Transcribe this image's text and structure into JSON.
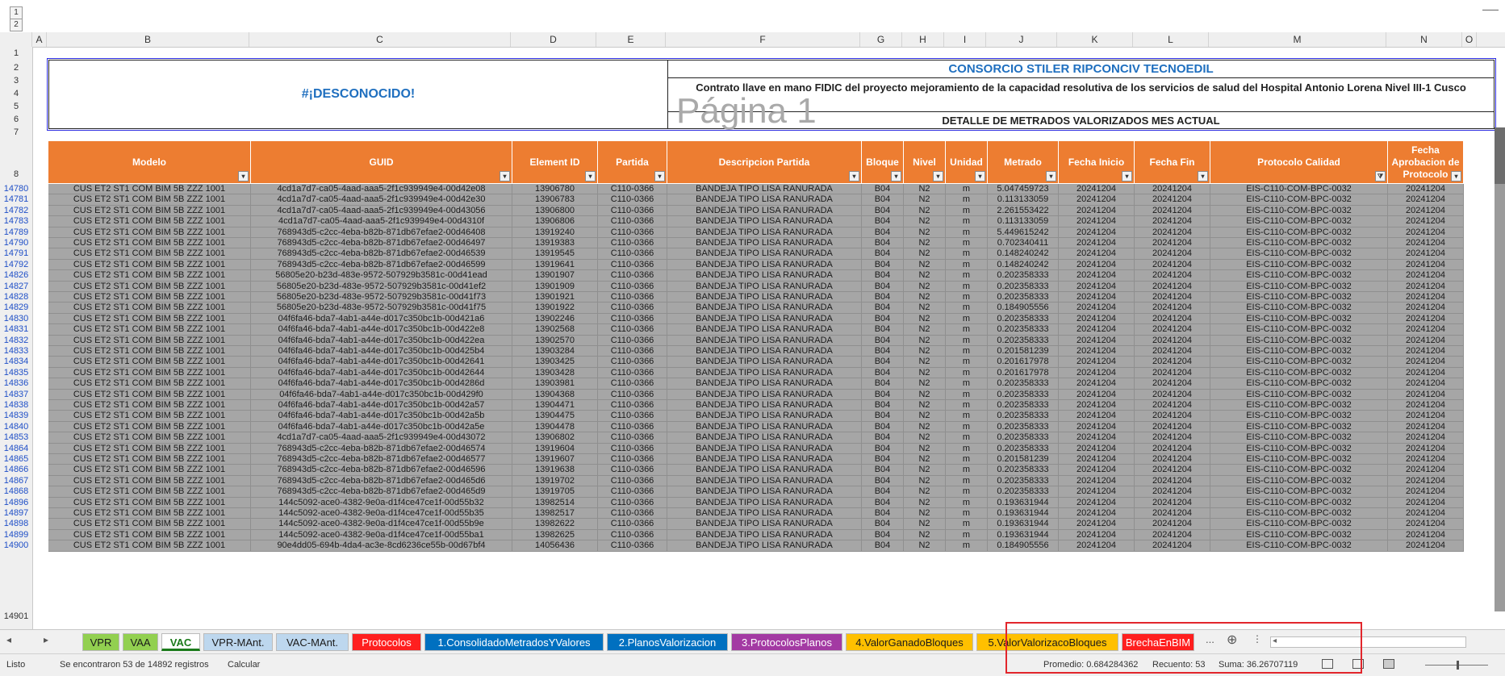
{
  "outline": [
    "1",
    "2"
  ],
  "columns": [
    "A",
    "B",
    "C",
    "D",
    "E",
    "F",
    "G",
    "H",
    "I",
    "J",
    "K",
    "L",
    "M",
    "N",
    "O"
  ],
  "header_row_numbers": [
    "1",
    "2",
    "3",
    "4",
    "5",
    "6",
    "7",
    "8"
  ],
  "banner": {
    "unknown": "#¡DESCONOCIDO!",
    "consorcio": "CONSORCIO STILER RIPCONCIV TECNOEDIL",
    "contrato": "Contrato llave en mano FIDIC del proyecto mejoramiento de la capacidad resolutiva de los servicios de salud del Hospital Antonio Lorena Nivel III-1 Cusco",
    "watermark": "Página 1",
    "detalle": "DETALLE DE METRADOS VALORIZADOS MES ACTUAL"
  },
  "table_headers": [
    "Modelo",
    "GUID",
    "Element ID",
    "Partida",
    "Descripcion Partida",
    "Bloque",
    "Nivel",
    "Unidad",
    "Metrado",
    "Fecha Inicio",
    "Fecha Fin",
    "Protocolo Calidad",
    "Fecha Aprobacion de Protocolo"
  ],
  "extra_header": "Recue",
  "rows": [
    [
      "14780",
      "CUS ET2 ST1 COM BIM 5B ZZZ 1001",
      "4cd1a7d7-ca05-4aad-aaa5-2f1c939949e4-00d42e08",
      "13906780",
      "C110-0366",
      "BANDEJA TIPO LISA RANURADA",
      "B04",
      "N2",
      "m",
      "5.047459723",
      "20241204",
      "20241204",
      "EIS-C110-COM-BPC-0032",
      "20241204"
    ],
    [
      "14781",
      "CUS ET2 ST1 COM BIM 5B ZZZ 1001",
      "4cd1a7d7-ca05-4aad-aaa5-2f1c939949e4-00d42e30",
      "13906783",
      "C110-0366",
      "BANDEJA TIPO LISA RANURADA",
      "B04",
      "N2",
      "m",
      "0.113133059",
      "20241204",
      "20241204",
      "EIS-C110-COM-BPC-0032",
      "20241204"
    ],
    [
      "14782",
      "CUS ET2 ST1 COM BIM 5B ZZZ 1001",
      "4cd1a7d7-ca05-4aad-aaa5-2f1c939949e4-00d43056",
      "13906800",
      "C110-0366",
      "BANDEJA TIPO LISA RANURADA",
      "B04",
      "N2",
      "m",
      "2.261553422",
      "20241204",
      "20241204",
      "EIS-C110-COM-BPC-0032",
      "20241204"
    ],
    [
      "14783",
      "CUS ET2 ST1 COM BIM 5B ZZZ 1001",
      "4cd1a7d7-ca05-4aad-aaa5-2f1c939949e4-00d4310f",
      "13906806",
      "C110-0366",
      "BANDEJA TIPO LISA RANURADA",
      "B04",
      "N2",
      "m",
      "0.113133059",
      "20241204",
      "20241204",
      "EIS-C110-COM-BPC-0032",
      "20241204"
    ],
    [
      "14789",
      "CUS ET2 ST1 COM BIM 5B ZZZ 1001",
      "768943d5-c2cc-4eba-b82b-871db67efae2-00d46408",
      "13919240",
      "C110-0366",
      "BANDEJA TIPO LISA RANURADA",
      "B04",
      "N2",
      "m",
      "5.449615242",
      "20241204",
      "20241204",
      "EIS-C110-COM-BPC-0032",
      "20241204"
    ],
    [
      "14790",
      "CUS ET2 ST1 COM BIM 5B ZZZ 1001",
      "768943d5-c2cc-4eba-b82b-871db67efae2-00d46497",
      "13919383",
      "C110-0366",
      "BANDEJA TIPO LISA RANURADA",
      "B04",
      "N2",
      "m",
      "0.702340411",
      "20241204",
      "20241204",
      "EIS-C110-COM-BPC-0032",
      "20241204"
    ],
    [
      "14791",
      "CUS ET2 ST1 COM BIM 5B ZZZ 1001",
      "768943d5-c2cc-4eba-b82b-871db67efae2-00d46539",
      "13919545",
      "C110-0366",
      "BANDEJA TIPO LISA RANURADA",
      "B04",
      "N2",
      "m",
      "0.148240242",
      "20241204",
      "20241204",
      "EIS-C110-COM-BPC-0032",
      "20241204"
    ],
    [
      "14792",
      "CUS ET2 ST1 COM BIM 5B ZZZ 1001",
      "768943d5-c2cc-4eba-b82b-871db67efae2-00d46599",
      "13919641",
      "C110-0366",
      "BANDEJA TIPO LISA RANURADA",
      "B04",
      "N2",
      "m",
      "0.148240242",
      "20241204",
      "20241204",
      "EIS-C110-COM-BPC-0032",
      "20241204"
    ],
    [
      "14826",
      "CUS ET2 ST1 COM BIM 5B ZZZ 1001",
      "56805e20-b23d-483e-9572-507929b3581c-00d41ead",
      "13901907",
      "C110-0366",
      "BANDEJA TIPO LISA RANURADA",
      "B04",
      "N2",
      "m",
      "0.202358333",
      "20241204",
      "20241204",
      "EIS-C110-COM-BPC-0032",
      "20241204"
    ],
    [
      "14827",
      "CUS ET2 ST1 COM BIM 5B ZZZ 1001",
      "56805e20-b23d-483e-9572-507929b3581c-00d41ef2",
      "13901909",
      "C110-0366",
      "BANDEJA TIPO LISA RANURADA",
      "B04",
      "N2",
      "m",
      "0.202358333",
      "20241204",
      "20241204",
      "EIS-C110-COM-BPC-0032",
      "20241204"
    ],
    [
      "14828",
      "CUS ET2 ST1 COM BIM 5B ZZZ 1001",
      "56805e20-b23d-483e-9572-507929b3581c-00d41f73",
      "13901921",
      "C110-0366",
      "BANDEJA TIPO LISA RANURADA",
      "B04",
      "N2",
      "m",
      "0.202358333",
      "20241204",
      "20241204",
      "EIS-C110-COM-BPC-0032",
      "20241204"
    ],
    [
      "14829",
      "CUS ET2 ST1 COM BIM 5B ZZZ 1001",
      "56805e20-b23d-483e-9572-507929b3581c-00d41f75",
      "13901922",
      "C110-0366",
      "BANDEJA TIPO LISA RANURADA",
      "B04",
      "N2",
      "m",
      "0.184905556",
      "20241204",
      "20241204",
      "EIS-C110-COM-BPC-0032",
      "20241204"
    ],
    [
      "14830",
      "CUS ET2 ST1 COM BIM 5B ZZZ 1001",
      "04f6fa46-bda7-4ab1-a44e-d017c350bc1b-00d421a6",
      "13902246",
      "C110-0366",
      "BANDEJA TIPO LISA RANURADA",
      "B04",
      "N2",
      "m",
      "0.202358333",
      "20241204",
      "20241204",
      "EIS-C110-COM-BPC-0032",
      "20241204"
    ],
    [
      "14831",
      "CUS ET2 ST1 COM BIM 5B ZZZ 1001",
      "04f6fa46-bda7-4ab1-a44e-d017c350bc1b-00d422e8",
      "13902568",
      "C110-0366",
      "BANDEJA TIPO LISA RANURADA",
      "B04",
      "N2",
      "m",
      "0.202358333",
      "20241204",
      "20241204",
      "EIS-C110-COM-BPC-0032",
      "20241204"
    ],
    [
      "14832",
      "CUS ET2 ST1 COM BIM 5B ZZZ 1001",
      "04f6fa46-bda7-4ab1-a44e-d017c350bc1b-00d422ea",
      "13902570",
      "C110-0366",
      "BANDEJA TIPO LISA RANURADA",
      "B04",
      "N2",
      "m",
      "0.202358333",
      "20241204",
      "20241204",
      "EIS-C110-COM-BPC-0032",
      "20241204"
    ],
    [
      "14833",
      "CUS ET2 ST1 COM BIM 5B ZZZ 1001",
      "04f6fa46-bda7-4ab1-a44e-d017c350bc1b-00d425b4",
      "13903284",
      "C110-0366",
      "BANDEJA TIPO LISA RANURADA",
      "B04",
      "N2",
      "m",
      "0.201581239",
      "20241204",
      "20241204",
      "EIS-C110-COM-BPC-0032",
      "20241204"
    ],
    [
      "14834",
      "CUS ET2 ST1 COM BIM 5B ZZZ 1001",
      "04f6fa46-bda7-4ab1-a44e-d017c350bc1b-00d42641",
      "13903425",
      "C110-0366",
      "BANDEJA TIPO LISA RANURADA",
      "B04",
      "N2",
      "m",
      "0.201617978",
      "20241204",
      "20241204",
      "EIS-C110-COM-BPC-0032",
      "20241204"
    ],
    [
      "14835",
      "CUS ET2 ST1 COM BIM 5B ZZZ 1001",
      "04f6fa46-bda7-4ab1-a44e-d017c350bc1b-00d42644",
      "13903428",
      "C110-0366",
      "BANDEJA TIPO LISA RANURADA",
      "B04",
      "N2",
      "m",
      "0.201617978",
      "20241204",
      "20241204",
      "EIS-C110-COM-BPC-0032",
      "20241204"
    ],
    [
      "14836",
      "CUS ET2 ST1 COM BIM 5B ZZZ 1001",
      "04f6fa46-bda7-4ab1-a44e-d017c350bc1b-00d4286d",
      "13903981",
      "C110-0366",
      "BANDEJA TIPO LISA RANURADA",
      "B04",
      "N2",
      "m",
      "0.202358333",
      "20241204",
      "20241204",
      "EIS-C110-COM-BPC-0032",
      "20241204"
    ],
    [
      "14837",
      "CUS ET2 ST1 COM BIM 5B ZZZ 1001",
      "04f6fa46-bda7-4ab1-a44e-d017c350bc1b-00d429f0",
      "13904368",
      "C110-0366",
      "BANDEJA TIPO LISA RANURADA",
      "B04",
      "N2",
      "m",
      "0.202358333",
      "20241204",
      "20241204",
      "EIS-C110-COM-BPC-0032",
      "20241204"
    ],
    [
      "14838",
      "CUS ET2 ST1 COM BIM 5B ZZZ 1001",
      "04f6fa46-bda7-4ab1-a44e-d017c350bc1b-00d42a57",
      "13904471",
      "C110-0366",
      "BANDEJA TIPO LISA RANURADA",
      "B04",
      "N2",
      "m",
      "0.202358333",
      "20241204",
      "20241204",
      "EIS-C110-COM-BPC-0032",
      "20241204"
    ],
    [
      "14839",
      "CUS ET2 ST1 COM BIM 5B ZZZ 1001",
      "04f6fa46-bda7-4ab1-a44e-d017c350bc1b-00d42a5b",
      "13904475",
      "C110-0366",
      "BANDEJA TIPO LISA RANURADA",
      "B04",
      "N2",
      "m",
      "0.202358333",
      "20241204",
      "20241204",
      "EIS-C110-COM-BPC-0032",
      "20241204"
    ],
    [
      "14840",
      "CUS ET2 ST1 COM BIM 5B ZZZ 1001",
      "04f6fa46-bda7-4ab1-a44e-d017c350bc1b-00d42a5e",
      "13904478",
      "C110-0366",
      "BANDEJA TIPO LISA RANURADA",
      "B04",
      "N2",
      "m",
      "0.202358333",
      "20241204",
      "20241204",
      "EIS-C110-COM-BPC-0032",
      "20241204"
    ],
    [
      "14853",
      "CUS ET2 ST1 COM BIM 5B ZZZ 1001",
      "4cd1a7d7-ca05-4aad-aaa5-2f1c939949e4-00d43072",
      "13906802",
      "C110-0366",
      "BANDEJA TIPO LISA RANURADA",
      "B04",
      "N2",
      "m",
      "0.202358333",
      "20241204",
      "20241204",
      "EIS-C110-COM-BPC-0032",
      "20241204"
    ],
    [
      "14864",
      "CUS ET2 ST1 COM BIM 5B ZZZ 1001",
      "768943d5-c2cc-4eba-b82b-871db67efae2-00d46574",
      "13919604",
      "C110-0366",
      "BANDEJA TIPO LISA RANURADA",
      "B04",
      "N2",
      "m",
      "0.202358333",
      "20241204",
      "20241204",
      "EIS-C110-COM-BPC-0032",
      "20241204"
    ],
    [
      "14865",
      "CUS ET2 ST1 COM BIM 5B ZZZ 1001",
      "768943d5-c2cc-4eba-b82b-871db67efae2-00d46577",
      "13919607",
      "C110-0366",
      "BANDEJA TIPO LISA RANURADA",
      "B04",
      "N2",
      "m",
      "0.201581239",
      "20241204",
      "20241204",
      "EIS-C110-COM-BPC-0032",
      "20241204"
    ],
    [
      "14866",
      "CUS ET2 ST1 COM BIM 5B ZZZ 1001",
      "768943d5-c2cc-4eba-b82b-871db67efae2-00d46596",
      "13919638",
      "C110-0366",
      "BANDEJA TIPO LISA RANURADA",
      "B04",
      "N2",
      "m",
      "0.202358333",
      "20241204",
      "20241204",
      "EIS-C110-COM-BPC-0032",
      "20241204"
    ],
    [
      "14867",
      "CUS ET2 ST1 COM BIM 5B ZZZ 1001",
      "768943d5-c2cc-4eba-b82b-871db67efae2-00d465d6",
      "13919702",
      "C110-0366",
      "BANDEJA TIPO LISA RANURADA",
      "B04",
      "N2",
      "m",
      "0.202358333",
      "20241204",
      "20241204",
      "EIS-C110-COM-BPC-0032",
      "20241204"
    ],
    [
      "14868",
      "CUS ET2 ST1 COM BIM 5B ZZZ 1001",
      "768943d5-c2cc-4eba-b82b-871db67efae2-00d465d9",
      "13919705",
      "C110-0366",
      "BANDEJA TIPO LISA RANURADA",
      "B04",
      "N2",
      "m",
      "0.202358333",
      "20241204",
      "20241204",
      "EIS-C110-COM-BPC-0032",
      "20241204"
    ],
    [
      "14896",
      "CUS ET2 ST1 COM BIM 5B ZZZ 1001",
      "144c5092-ace0-4382-9e0a-d1f4ce47ce1f-00d55b32",
      "13982514",
      "C110-0366",
      "BANDEJA TIPO LISA RANURADA",
      "B04",
      "N2",
      "m",
      "0.193631944",
      "20241204",
      "20241204",
      "EIS-C110-COM-BPC-0032",
      "20241204"
    ],
    [
      "14897",
      "CUS ET2 ST1 COM BIM 5B ZZZ 1001",
      "144c5092-ace0-4382-9e0a-d1f4ce47ce1f-00d55b35",
      "13982517",
      "C110-0366",
      "BANDEJA TIPO LISA RANURADA",
      "B04",
      "N2",
      "m",
      "0.193631944",
      "20241204",
      "20241204",
      "EIS-C110-COM-BPC-0032",
      "20241204"
    ],
    [
      "14898",
      "CUS ET2 ST1 COM BIM 5B ZZZ 1001",
      "144c5092-ace0-4382-9e0a-d1f4ce47ce1f-00d55b9e",
      "13982622",
      "C110-0366",
      "BANDEJA TIPO LISA RANURADA",
      "B04",
      "N2",
      "m",
      "0.193631944",
      "20241204",
      "20241204",
      "EIS-C110-COM-BPC-0032",
      "20241204"
    ],
    [
      "14899",
      "CUS ET2 ST1 COM BIM 5B ZZZ 1001",
      "144c5092-ace0-4382-9e0a-d1f4ce47ce1f-00d55ba1",
      "13982625",
      "C110-0366",
      "BANDEJA TIPO LISA RANURADA",
      "B04",
      "N2",
      "m",
      "0.193631944",
      "20241204",
      "20241204",
      "EIS-C110-COM-BPC-0032",
      "20241204"
    ],
    [
      "14900",
      "CUS ET2 ST1 COM BIM 5B ZZZ 1001",
      "90e4dd05-694b-4da4-ac3e-8cd6236ce55b-00d67bf4",
      "14056436",
      "C110-0366",
      "BANDEJA TIPO LISA RANURADA",
      "B04",
      "N2",
      "m",
      "0.184905556",
      "20241204",
      "20241204",
      "EIS-C110-COM-BPC-0032",
      "20241204"
    ]
  ],
  "last_row_number": "14901",
  "tabs": [
    {
      "label": "VPR",
      "bg": "#92d050",
      "fg": "#1a1a1a"
    },
    {
      "label": "VAA",
      "bg": "#92d050",
      "fg": "#1a1a1a"
    },
    {
      "label": "VAC",
      "bg": "#ffffff",
      "fg": "#1a7a1a"
    },
    {
      "label": "VPR-MAnt.",
      "bg": "#bdd7ee",
      "fg": "#1a1a1a"
    },
    {
      "label": "VAC-MAnt.",
      "bg": "#bdd7ee",
      "fg": "#1a1a1a"
    },
    {
      "label": "Protocolos",
      "bg": "#ff1f1f",
      "fg": "#ffffff"
    },
    {
      "label": "1.ConsolidadoMetradosYValores",
      "bg": "#0070c0",
      "fg": "#ffffff"
    },
    {
      "label": "2.PlanosValorizacion",
      "bg": "#0070c0",
      "fg": "#ffffff"
    },
    {
      "label": "3.ProtocolosPlanos",
      "bg": "#a33aa3",
      "fg": "#ffffff"
    },
    {
      "label": "4.ValorGanadoBloques",
      "bg": "#ffc000",
      "fg": "#1a1a1a"
    },
    {
      "label": "5.ValorValorizacoBloques",
      "bg": "#ffc000",
      "fg": "#1a1a1a"
    },
    {
      "label": "BrechaEnBIM",
      "bg": "#ff1f1f",
      "fg": "#ffffff"
    }
  ],
  "tab_more": "...",
  "status": {
    "ready": "Listo",
    "found": "Se encontraron 53 de 14892 registros",
    "calc": "Calcular",
    "promedio": "Promedio: 0.684284362",
    "recuento": "Recuento: 53",
    "suma": "Suma: 36.26707119"
  },
  "colors": {
    "header_orange": "#ed7d31",
    "row_gray": "#a6a6a6",
    "highlight": "#e2262c"
  }
}
